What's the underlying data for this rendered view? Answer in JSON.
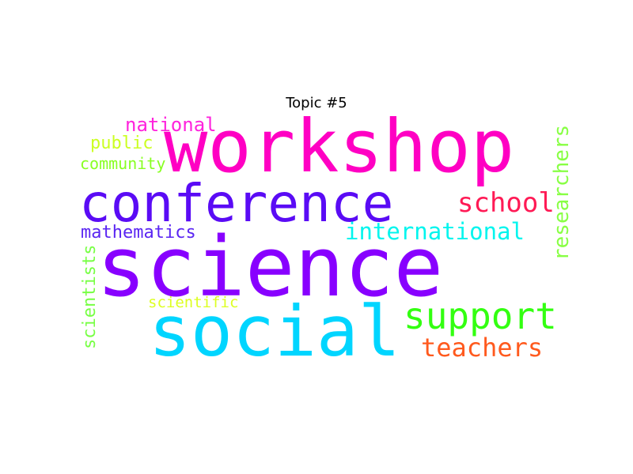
{
  "figure": {
    "title": "Topic #5",
    "words": [
      {
        "text": "workshop",
        "color": "#ff00c3"
      },
      {
        "text": "conference",
        "color": "#5a0bf5"
      },
      {
        "text": "science",
        "color": "#8800ff"
      },
      {
        "text": "social",
        "color": "#00d5ff"
      },
      {
        "text": "support",
        "color": "#33ff11"
      },
      {
        "text": "teachers",
        "color": "#ff5a1e"
      },
      {
        "text": "school",
        "color": "#ff1a55"
      },
      {
        "text": "international",
        "color": "#00f5ee"
      },
      {
        "text": "mathematics",
        "color": "#5a25f2"
      },
      {
        "text": "national",
        "color": "#ff22dd"
      },
      {
        "text": "public",
        "color": "#ccff22"
      },
      {
        "text": "community",
        "color": "#88ff22"
      },
      {
        "text": "scientific",
        "color": "#ddff22"
      },
      {
        "text": "researchers",
        "color": "#88ff44"
      },
      {
        "text": "scientists",
        "color": "#77ff44"
      }
    ]
  }
}
